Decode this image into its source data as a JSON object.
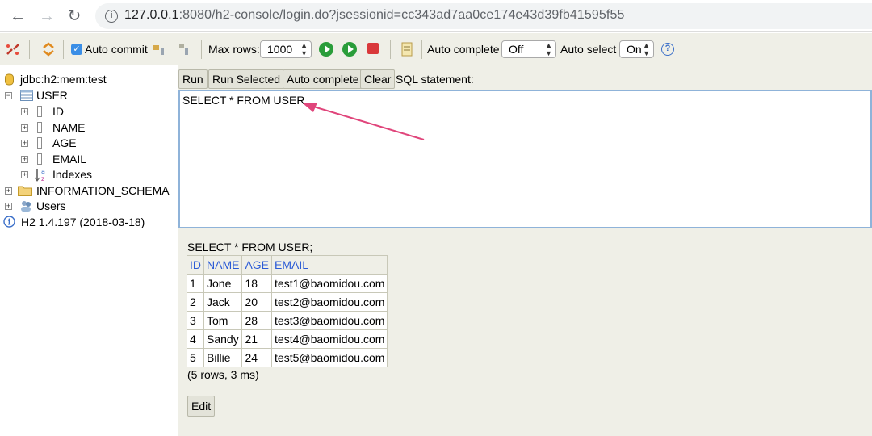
{
  "browser": {
    "url_host": "127.0.0.1",
    "url_rest": ":8080/h2-console/login.do?jsessionid=cc343ad7aa0ce174e43d39fb41595f55"
  },
  "toolbar": {
    "auto_commit_label": "Auto commit",
    "auto_commit_checked": true,
    "max_rows_label": "Max rows:",
    "max_rows_value": "1000",
    "auto_complete_label": "Auto complete",
    "auto_complete_value": "Off",
    "auto_select_label": "Auto select",
    "auto_select_value": "On",
    "help_glyph": "?"
  },
  "tree": {
    "connection": "jdbc:h2:mem:test",
    "table": "USER",
    "columns": [
      "ID",
      "NAME",
      "AGE",
      "EMAIL"
    ],
    "indexes": "Indexes",
    "schema": "INFORMATION_SCHEMA",
    "users": "Users",
    "version": "H2 1.4.197 (2018-03-18)"
  },
  "buttons": {
    "run": "Run",
    "run_selected": "Run Selected",
    "auto_complete": "Auto complete",
    "clear": "Clear",
    "sql_label": "SQL statement:"
  },
  "editor": {
    "text": "SELECT * FROM USER"
  },
  "result": {
    "sql": "SELECT * FROM USER;",
    "headers": [
      "ID",
      "NAME",
      "AGE",
      "EMAIL"
    ],
    "rows": [
      [
        "1",
        "Jone",
        "18",
        "test1@baomidou.com"
      ],
      [
        "2",
        "Jack",
        "20",
        "test2@baomidou.com"
      ],
      [
        "3",
        "Tom",
        "28",
        "test3@baomidou.com"
      ],
      [
        "4",
        "Sandy",
        "21",
        "test4@baomidou.com"
      ],
      [
        "5",
        "Billie",
        "24",
        "test5@baomidou.com"
      ]
    ],
    "summary": "(5 rows, 3 ms)",
    "edit_label": "Edit"
  },
  "colors": {
    "panel_bg": "#efefe7",
    "header_text": "#2a5ad6",
    "annotation_arrow": "#e0457b"
  }
}
